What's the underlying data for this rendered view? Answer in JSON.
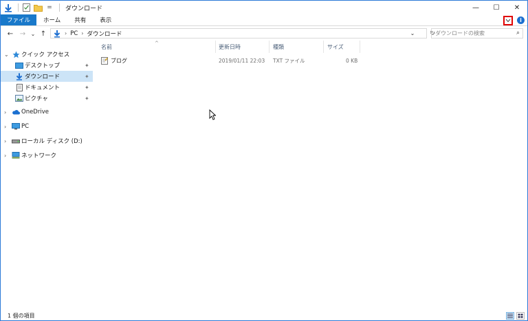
{
  "window": {
    "title": "ダウンロード",
    "quick_access_dropdown": "=",
    "controls": {
      "minimize": "—",
      "maximize": "☐",
      "close": "✕"
    }
  },
  "ribbon": {
    "tabs": [
      {
        "label": "ファイル",
        "active": true
      },
      {
        "label": "ホーム"
      },
      {
        "label": "共有"
      },
      {
        "label": "表示"
      }
    ],
    "help_label": "i"
  },
  "address_bar": {
    "back": "←",
    "forward": "→",
    "recent": "⌄",
    "up": "↑",
    "crumb_separator": "›",
    "breadcrumbs": [
      "PC",
      "ダウンロード"
    ],
    "dropdown": "⌄",
    "refresh": "↻"
  },
  "search": {
    "placeholder": "ダウンロードの検索",
    "icon": "⌕"
  },
  "nav_pane": {
    "quick_access": "クイック アクセス",
    "quick_items": [
      {
        "label": "デスクトップ",
        "pinned": true
      },
      {
        "label": "ダウンロード",
        "pinned": true,
        "selected": true
      },
      {
        "label": "ドキュメント",
        "pinned": true
      },
      {
        "label": "ピクチャ",
        "pinned": true
      }
    ],
    "roots": [
      {
        "label": "OneDrive"
      },
      {
        "label": "PC"
      },
      {
        "label": "ローカル ディスク (D:)"
      },
      {
        "label": "ネットワーク"
      }
    ],
    "expand_glyph": "›",
    "collapse_glyph": "⌄",
    "pin_glyph": "✦"
  },
  "file_list": {
    "columns": [
      "名前",
      "更新日時",
      "種類",
      "サイズ"
    ],
    "sort_indicator": "^",
    "rows": [
      {
        "name": "ブログ",
        "modified": "2019/01/11 22:03",
        "type": "TXT ファイル",
        "size": "0 KB"
      }
    ]
  },
  "status_bar": {
    "item_count": "1 個の項目"
  },
  "colors": {
    "accent": "#1979ca",
    "selection": "#cce4f7",
    "highlight_box": "#e00000"
  }
}
